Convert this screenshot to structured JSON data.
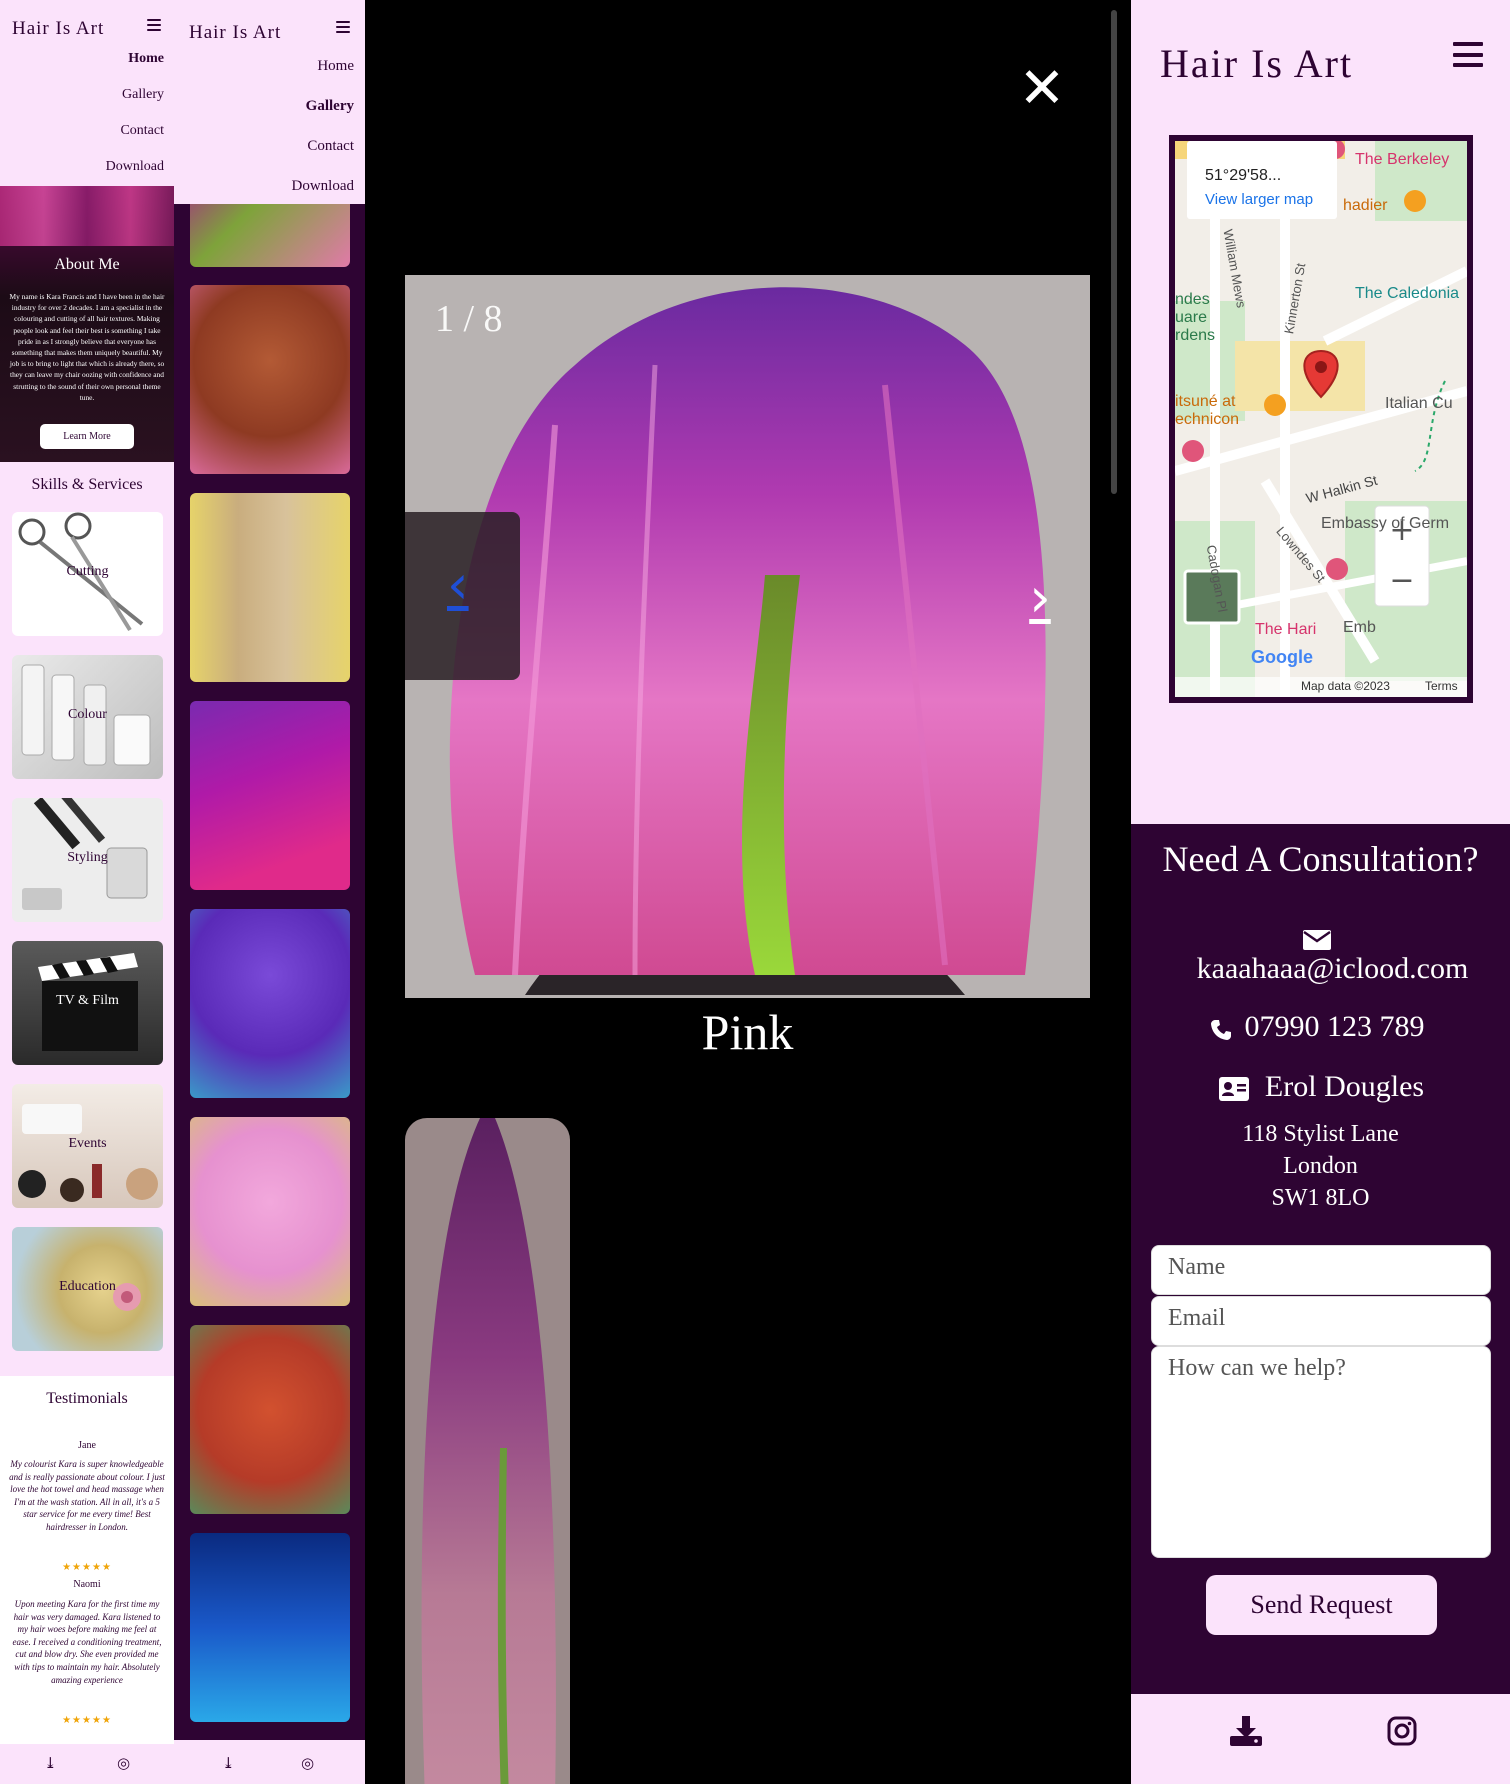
{
  "site": {
    "logo": "Hair Is Art"
  },
  "nav": [
    {
      "label": "Home"
    },
    {
      "label": "Gallery"
    },
    {
      "label": "Contact"
    },
    {
      "label": "Download"
    }
  ],
  "about": {
    "title": "About Me",
    "text": "My name is Kara Francis and I have been in the hair industry for over 2 decades. I am a specialist in the colouring and cutting of all hair textures. Making people look and feel their best is something I take pride in as I strongly believe that everyone has something that makes them uniquely beautiful. My job is to bring to light that which is already there, so they can leave my chair oozing with confidence and strutting to the sound of their own personal theme tune.",
    "button": "Learn More"
  },
  "skills": {
    "title": "Skills & Services",
    "items": [
      {
        "label": "Cutting",
        "icon": "scissors-icon"
      },
      {
        "label": "Colour",
        "icon": "colour-tubes-icon"
      },
      {
        "label": "Styling",
        "icon": "combs-icon"
      },
      {
        "label": "TV & Film",
        "icon": "clapperboard-icon"
      },
      {
        "label": "Events",
        "icon": "makeup-icon"
      },
      {
        "label": "Education",
        "icon": "hair-bun-icon"
      }
    ]
  },
  "testimonials": {
    "title": "Testimonials",
    "items": [
      {
        "name": "Jane",
        "quote": "My colourist Kara is super knowledgeable and is really passionate about colour. I just love the hot towel and head massage when I'm at the wash station. All in all, it's a 5 star service for me every time! Best hairdresser in London.",
        "stars": "★★★★★"
      },
      {
        "name": "Naomi",
        "quote": "Upon meeting Kara for the first time my hair was very damaged. Kara listened to my hair woes before making me feel at ease. I received a conditioning treatment, cut and blow dry. She even provided me with tips to maintain my hair. Absolutely amazing experience",
        "stars": "★★★★★"
      }
    ]
  },
  "gallery": {
    "colors": [
      "#c1457d",
      "#8e3a22",
      "#c9ad7e",
      "#b01aa8",
      "#6a37c8",
      "#e691cf",
      "#b53b28",
      "#1a59c9"
    ]
  },
  "lightbox": {
    "counter": "1 / 8",
    "caption": "Pink",
    "close_icon": "close-icon",
    "prev_icon": "chevron-left-icon",
    "next_icon": "chevron-right-icon"
  },
  "map": {
    "coords": "51°29'58...",
    "larger_link": "View larger map",
    "labels": [
      "The Berkeley",
      "hadier",
      "The Caledonia",
      "Italian Cu",
      "W Halkin St",
      "Embassy of Germ",
      "The Hari",
      "Lowndes St",
      "Kinnerton St",
      "William Mews",
      "Cadogan Pl",
      "itsuné at",
      "echnicon",
      "ndes",
      "uare",
      "rdens",
      "Emb"
    ],
    "google": "Google",
    "attribution": "Map data ©2023",
    "terms": "Terms",
    "zoom_in": "+",
    "zoom_out": "−"
  },
  "contact": {
    "title": "Need A Consultation?",
    "email": "kaaahaaa@iclood.com",
    "phone": "07990 123 789",
    "name": "Erol Dougles",
    "address": [
      "118 Stylist Lane",
      "London",
      "SW1 8LO"
    ],
    "form": {
      "name_placeholder": "Name",
      "email_placeholder": "Email",
      "message_placeholder": "How can we help?",
      "submit": "Send Request"
    }
  },
  "footer": {
    "icons": [
      "download-icon",
      "instagram-icon"
    ]
  },
  "accent": {
    "dark": "#2e0433",
    "light": "#fbe3fb"
  }
}
